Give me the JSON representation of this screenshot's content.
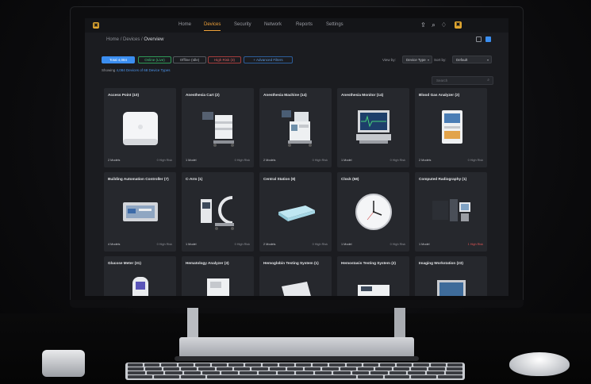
{
  "nav": {
    "items": [
      {
        "label": "Home",
        "active": false
      },
      {
        "label": "Devices",
        "active": true
      },
      {
        "label": "Security",
        "active": false
      },
      {
        "label": "Network",
        "active": false
      },
      {
        "label": "Reports",
        "active": false
      },
      {
        "label": "Settings",
        "active": false
      }
    ],
    "icons": [
      "export-icon",
      "search-icon",
      "notification-icon",
      "profile-icon"
    ]
  },
  "breadcrumb": {
    "home": "Home",
    "sep": "/",
    "devices": "Devices",
    "current": "Overview"
  },
  "filters": [
    {
      "label": "Total 4,084"
    },
    {
      "label": "Online (Live)"
    },
    {
      "label": "Offline (Idle)"
    },
    {
      "label": "High Risk (3)"
    },
    {
      "label": "+ Advanced Filters"
    }
  ],
  "view_by": {
    "label": "View by:",
    "value": "Device Type"
  },
  "sort_by": {
    "label": "Sort by:",
    "value": "Default"
  },
  "showing": {
    "prefix": "Showing",
    "count": "4,084 Devices of 68 Device Types"
  },
  "search": {
    "placeholder": "Search"
  },
  "cards": [
    {
      "title": "Access Point (10)",
      "models": "2 Models",
      "risk": "0 High Risk",
      "icon": "access-point-icon",
      "high": false
    },
    {
      "title": "Anesthesia Cart (2)",
      "models": "1 Model",
      "risk": "0 High Risk",
      "icon": "anesthesia-cart-icon",
      "high": false
    },
    {
      "title": "Anesthesia Machine (14)",
      "models": "2 Models",
      "risk": "0 High Risk",
      "icon": "anesthesia-machine-icon",
      "high": false
    },
    {
      "title": "Anesthesia Monitor (14)",
      "models": "1 Model",
      "risk": "0 High Risk",
      "icon": "anesthesia-monitor-icon",
      "high": false
    },
    {
      "title": "Blood Gas Analyzer (2)",
      "models": "2 Models",
      "risk": "0 High Risk",
      "icon": "blood-gas-analyzer-icon",
      "high": false
    },
    {
      "title": "Building Automation Controller (7)",
      "models": "4 Models",
      "risk": "0 High Risk",
      "icon": "building-controller-icon",
      "high": false
    },
    {
      "title": "C-Arm (1)",
      "models": "1 Model",
      "risk": "0 High Risk",
      "icon": "c-arm-icon",
      "high": false
    },
    {
      "title": "Central Station (8)",
      "models": "2 Models",
      "risk": "0 High Risk",
      "icon": "central-station-icon",
      "high": false
    },
    {
      "title": "Clock (58)",
      "models": "1 Model",
      "risk": "0 High Risk",
      "icon": "clock-icon",
      "high": false
    },
    {
      "title": "Computed Radiography (1)",
      "models": "1 Model",
      "risk": "1 High Risk",
      "icon": "radiography-icon",
      "high": true
    },
    {
      "title": "Glucose Meter (31)",
      "models": "",
      "risk": "",
      "icon": "glucose-meter-icon",
      "high": false
    },
    {
      "title": "Hematology Analyzer (3)",
      "models": "",
      "risk": "",
      "icon": "hematology-analyzer-icon",
      "high": false
    },
    {
      "title": "Hemoglobin Testing System (1)",
      "models": "",
      "risk": "",
      "icon": "hemoglobin-system-icon",
      "high": false
    },
    {
      "title": "Hemostasis Testing System (2)",
      "models": "",
      "risk": "",
      "icon": "hemostasis-system-icon",
      "high": false
    },
    {
      "title": "Imaging Workstation (23)",
      "models": "",
      "risk": "",
      "icon": "imaging-workstation-icon",
      "high": false
    }
  ],
  "colors": {
    "accent": "#f0a23a",
    "primary": "#3b8ef0",
    "online": "#41c77a",
    "risk": "#e05555",
    "card": "#26282d",
    "bg": "#1b1c20"
  }
}
